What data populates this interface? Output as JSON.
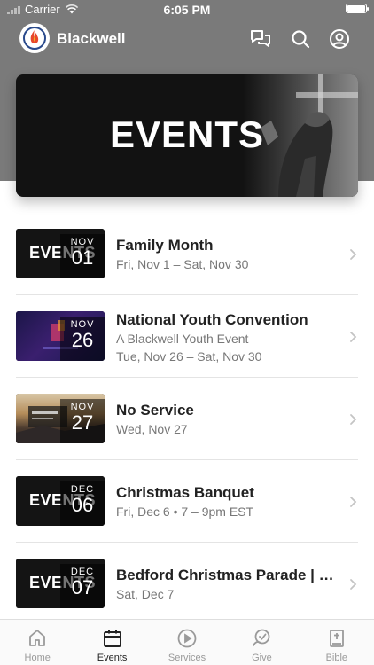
{
  "status": {
    "carrier": "Carrier",
    "time": "6:05 PM"
  },
  "header": {
    "app_name": "Blackwell",
    "icons": [
      "messages-icon",
      "search-icon",
      "profile-icon"
    ]
  },
  "hero": {
    "title": "EVENTS"
  },
  "events": [
    {
      "thumb_text": "EVENTS",
      "month": "NOV",
      "day": "01",
      "title": "Family Month",
      "subtitle": "Fri, Nov 1 – Sat, Nov 30",
      "subtitle2": ""
    },
    {
      "thumb_text": "",
      "month": "NOV",
      "day": "26",
      "title": "National Youth Convention",
      "subtitle": "A Blackwell Youth Event",
      "subtitle2": "Tue, Nov 26 – Sat, Nov 30"
    },
    {
      "thumb_text": "",
      "month": "NOV",
      "day": "27",
      "title": "No Service",
      "subtitle": "Wed, Nov 27",
      "subtitle2": ""
    },
    {
      "thumb_text": "EVENTS",
      "month": "DEC",
      "day": "06",
      "title": "Christmas Banquet",
      "subtitle": "Fri, Dec 6 • 7 – 9pm EST",
      "subtitle2": ""
    },
    {
      "thumb_text": "EVENTS",
      "month": "DEC",
      "day": "07",
      "title": "Bedford Christmas Parade | Co...",
      "subtitle": "Sat, Dec 7",
      "subtitle2": ""
    }
  ],
  "tabs": [
    {
      "label": "Home",
      "icon": "home-icon",
      "active": false
    },
    {
      "label": "Events",
      "icon": "calendar-icon",
      "active": true
    },
    {
      "label": "Services",
      "icon": "play-icon",
      "active": false
    },
    {
      "label": "Give",
      "icon": "give-icon",
      "active": false
    },
    {
      "label": "Bible",
      "icon": "bible-icon",
      "active": false
    }
  ],
  "colors": {
    "header_band": "#7a7a7a",
    "accent_active": "#222222",
    "inactive": "#9a9a9a"
  }
}
